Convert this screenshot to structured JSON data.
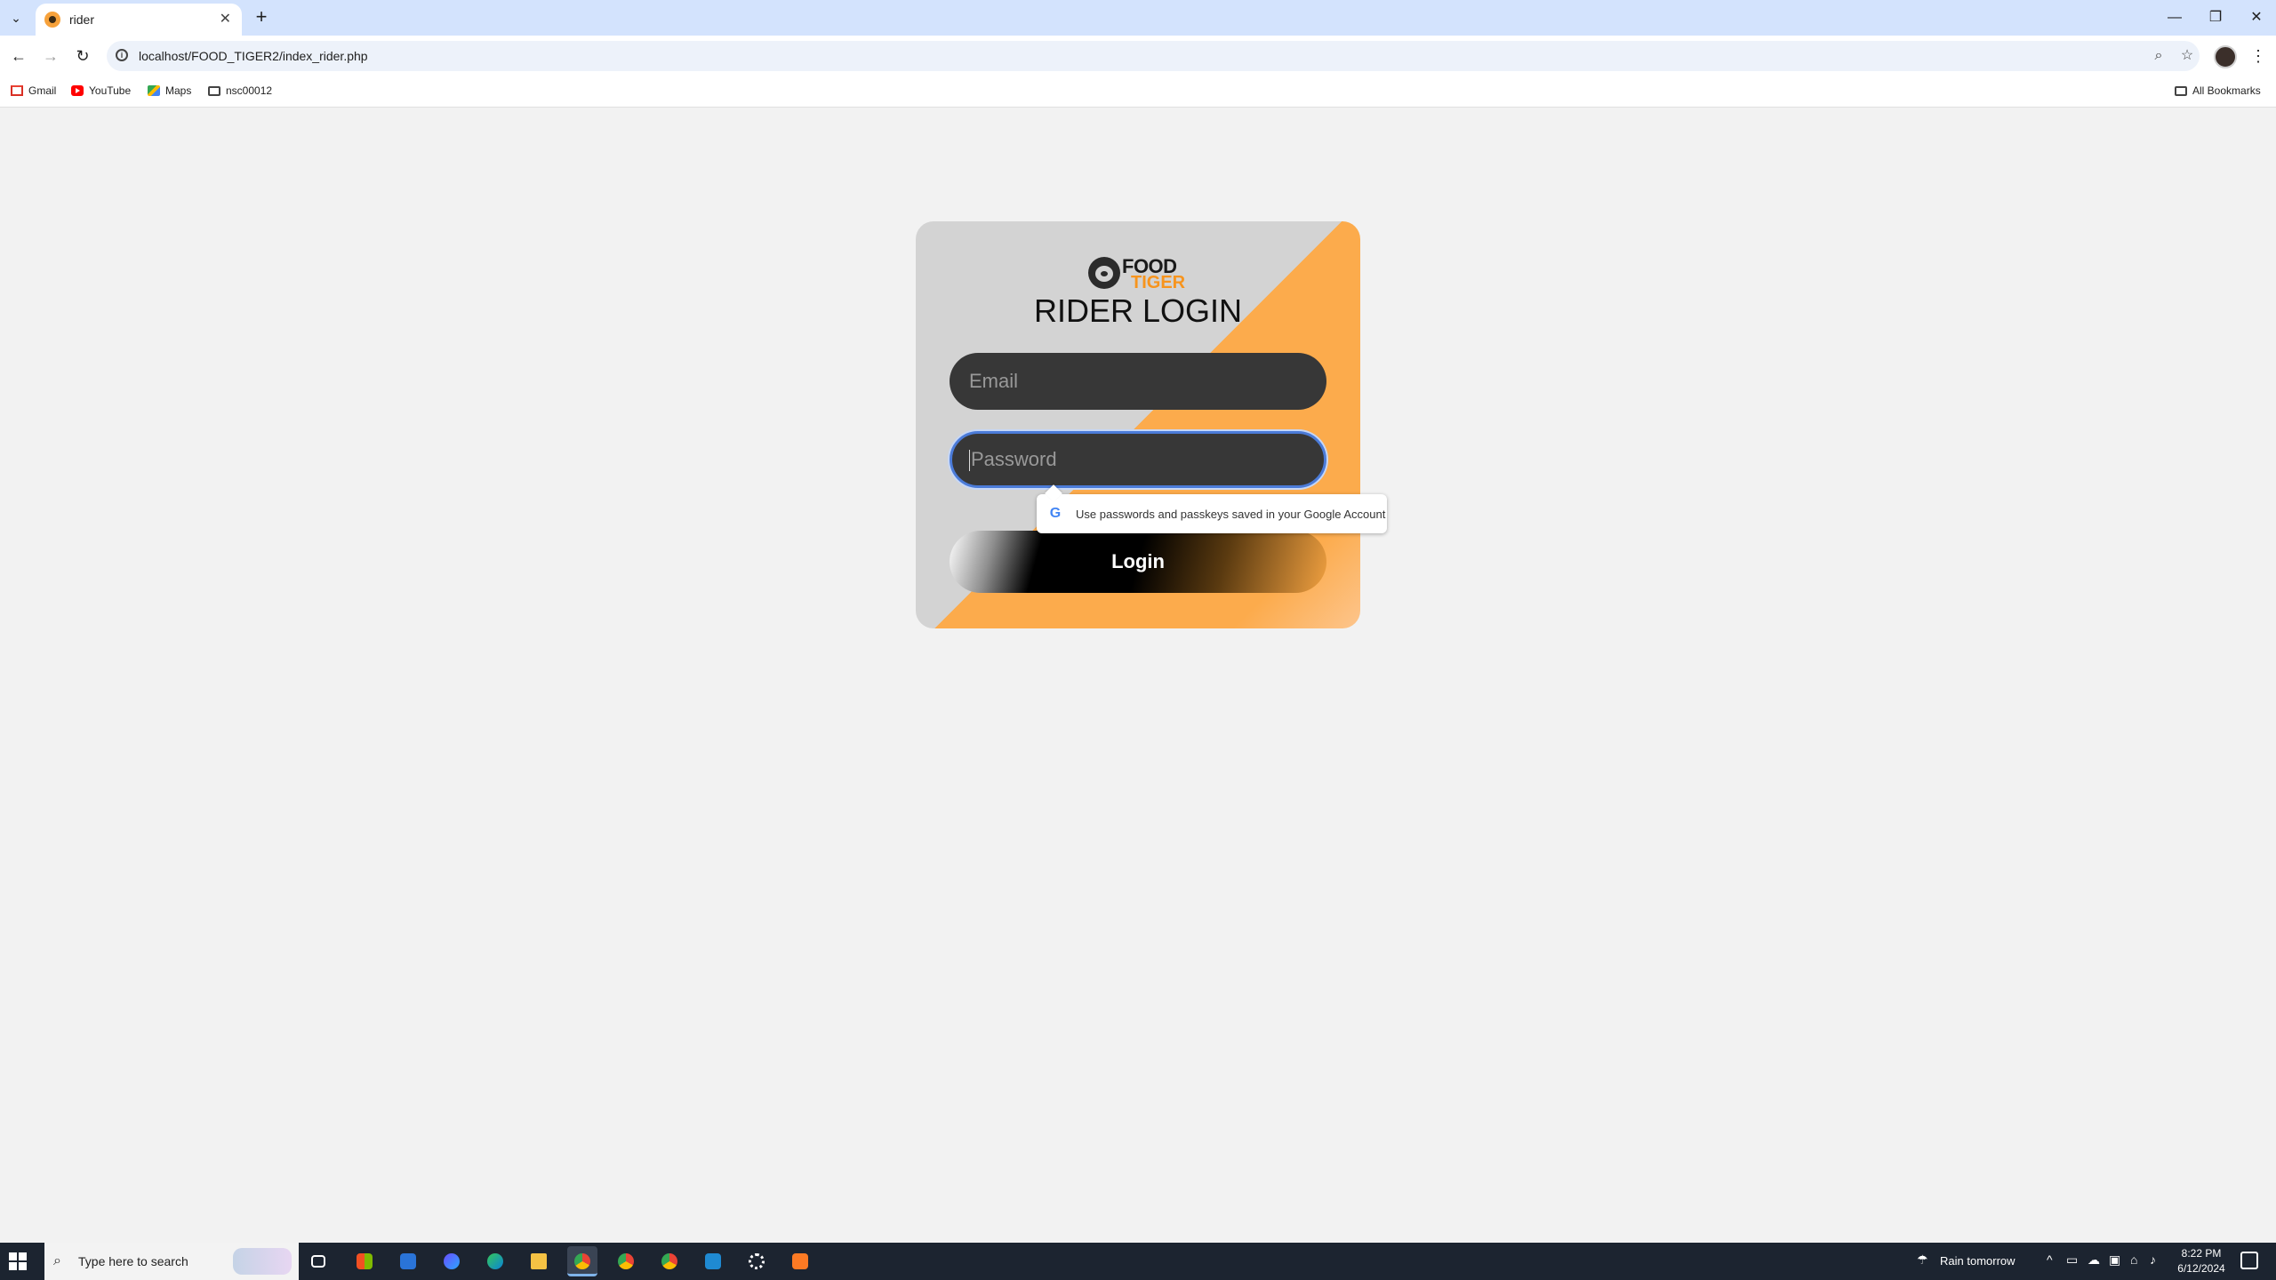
{
  "browser": {
    "tab": {
      "title": "rider",
      "favicon": "tiger-favicon",
      "close_glyph": "✕"
    },
    "new_tab_glyph": "+",
    "window_controls": {
      "minimize": "—",
      "restore": "❐",
      "close": "✕"
    },
    "nav": {
      "back": "←",
      "forward": "→",
      "reload": "↻"
    },
    "url": "localhost/FOOD_TIGER2/index_rider.php",
    "omnibox_icons": {
      "zoom": "⌕",
      "bookmark": "☆"
    },
    "menu_glyph": "⋮",
    "bookmarks": [
      {
        "label": "Gmail",
        "icon": "gmail-icon"
      },
      {
        "label": "YouTube",
        "icon": "youtube-icon"
      },
      {
        "label": "Maps",
        "icon": "maps-icon"
      },
      {
        "label": "nsc00012",
        "icon": "folder-icon"
      }
    ],
    "all_bookmarks": "All Bookmarks"
  },
  "login": {
    "logo": {
      "line1": "FOOD",
      "line2": "TIGER"
    },
    "title": "RIDER LOGIN",
    "email_placeholder": "Email",
    "password_placeholder": "Password",
    "button": "Login",
    "password_tooltip": "Use passwords and passkeys saved in your Google Account",
    "colors": {
      "accent": "#fcab4c",
      "card_gray": "#d3d3d3",
      "field_bg": "#373737",
      "focus_ring": "#4b7bd8"
    }
  },
  "taskbar": {
    "search_placeholder": "Type here to search",
    "weather": "Rain tomorrow",
    "time": "8:22 PM",
    "date": "6/12/2024",
    "apps": [
      "task-view",
      "microsoft-store",
      "mail",
      "copilot",
      "edge",
      "file-explorer",
      "chrome",
      "chrome",
      "chrome",
      "vscode",
      "settings",
      "xampp"
    ]
  }
}
